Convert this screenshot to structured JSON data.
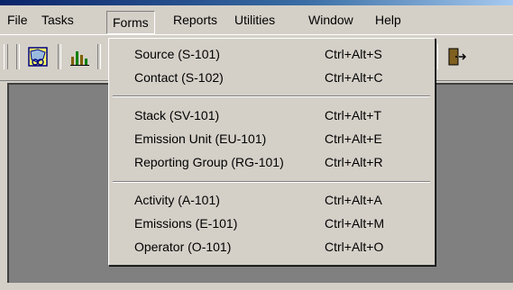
{
  "menubar": {
    "items": [
      "File",
      "Tasks",
      "Forms",
      "Reports",
      "Utilities",
      "Window",
      "Help"
    ]
  },
  "toolbar": {
    "icons": [
      "map-icon",
      "chart-icon",
      "exit-door-icon"
    ]
  },
  "forms_menu": {
    "groups": [
      [
        {
          "label": "Source (S-101)",
          "shortcut": "Ctrl+Alt+S"
        },
        {
          "label": "Contact (S-102)",
          "shortcut": "Ctrl+Alt+C"
        }
      ],
      [
        {
          "label": "Stack (SV-101)",
          "shortcut": "Ctrl+Alt+T"
        },
        {
          "label": "Emission Unit (EU-101)",
          "shortcut": "Ctrl+Alt+E"
        },
        {
          "label": "Reporting Group (RG-101)",
          "shortcut": "Ctrl+Alt+R"
        }
      ],
      [
        {
          "label": "Activity (A-101)",
          "shortcut": "Ctrl+Alt+A"
        },
        {
          "label": "Emissions (E-101)",
          "shortcut": "Ctrl+Alt+M"
        },
        {
          "label": "Operator (O-101)",
          "shortcut": "Ctrl+Alt+O"
        }
      ]
    ]
  }
}
